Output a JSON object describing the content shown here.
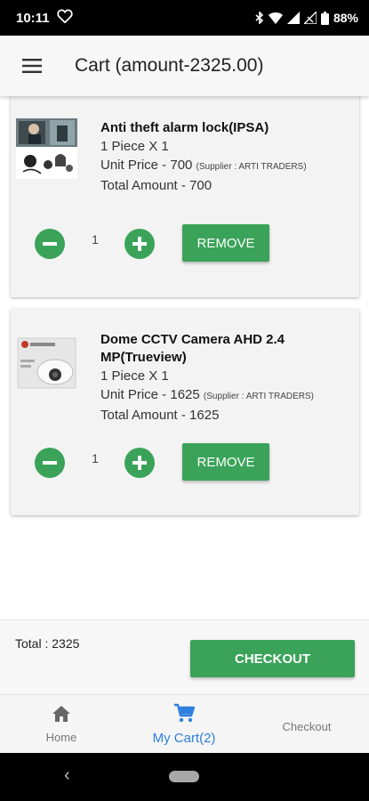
{
  "status_bar": {
    "time": "10:11",
    "battery": "88%"
  },
  "app_bar": {
    "title": "Cart (amount-2325.00)",
    "menu_icon": "hamburger-menu-icon"
  },
  "cart_items": [
    {
      "name": "Anti theft alarm lock(IPSA)",
      "quantity_line": "1 Piece X 1",
      "unit_price": "Unit Price - 700",
      "supplier": "(Supplier : ARTI TRADERS)",
      "total_amount": "Total Amount - 700",
      "quantity": "1",
      "remove_label": "REMOVE"
    },
    {
      "name": "Dome CCTV Camera AHD 2.4 MP(Trueview)",
      "quantity_line": "1 Piece X 1",
      "unit_price": "Unit Price - 1625",
      "supplier": "(Supplier : ARTI TRADERS)",
      "total_amount": "Total Amount - 1625",
      "quantity": "1",
      "remove_label": "REMOVE"
    }
  ],
  "footer": {
    "total": "Total : 2325",
    "checkout_label": "CHECKOUT"
  },
  "bottom_nav": {
    "items": [
      {
        "label": "Home",
        "icon": "home-icon"
      },
      {
        "label": "My Cart(2)",
        "icon": "cart-icon",
        "active": true
      },
      {
        "label": "Checkout",
        "icon": ""
      }
    ]
  },
  "colors": {
    "accent_green": "#3aa359",
    "active_blue": "#2f7fe0"
  }
}
